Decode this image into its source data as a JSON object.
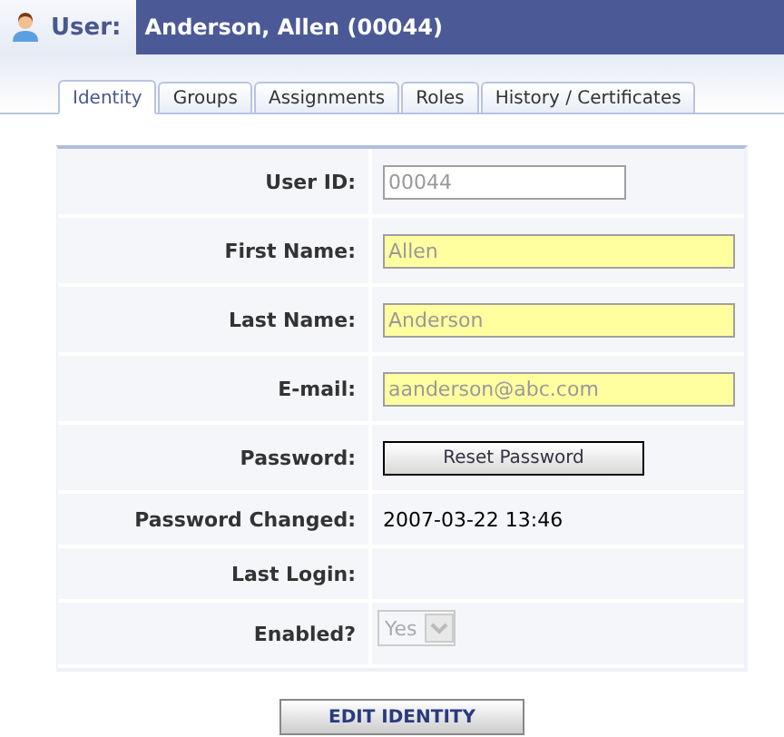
{
  "header": {
    "label": "User:",
    "title": "Anderson, Allen (00044)"
  },
  "tabs": [
    {
      "label": "Identity",
      "selected": true
    },
    {
      "label": "Groups",
      "selected": false
    },
    {
      "label": "Assignments",
      "selected": false
    },
    {
      "label": "Roles",
      "selected": false
    },
    {
      "label": "History / Certificates",
      "selected": false
    }
  ],
  "form": [
    {
      "label": "User ID:",
      "kind": "input",
      "value": "00044",
      "required": false
    },
    {
      "label": "First Name:",
      "kind": "input",
      "value": "Allen",
      "required": true
    },
    {
      "label": "Last Name:",
      "kind": "input",
      "value": "Anderson",
      "required": true
    },
    {
      "label": "E-mail:",
      "kind": "input",
      "value": "aanderson@abc.com",
      "required": true
    },
    {
      "label": "Password:",
      "kind": "button",
      "value": "Reset Password"
    },
    {
      "label": "Password Changed:",
      "kind": "text",
      "value": "2007-03-22 13:46"
    },
    {
      "label": "Last Login:",
      "kind": "text"
    },
    {
      "label": "Enabled?",
      "kind": "select",
      "value": "Yes",
      "disabled": true
    }
  ],
  "action": "EDIT IDENTITY"
}
